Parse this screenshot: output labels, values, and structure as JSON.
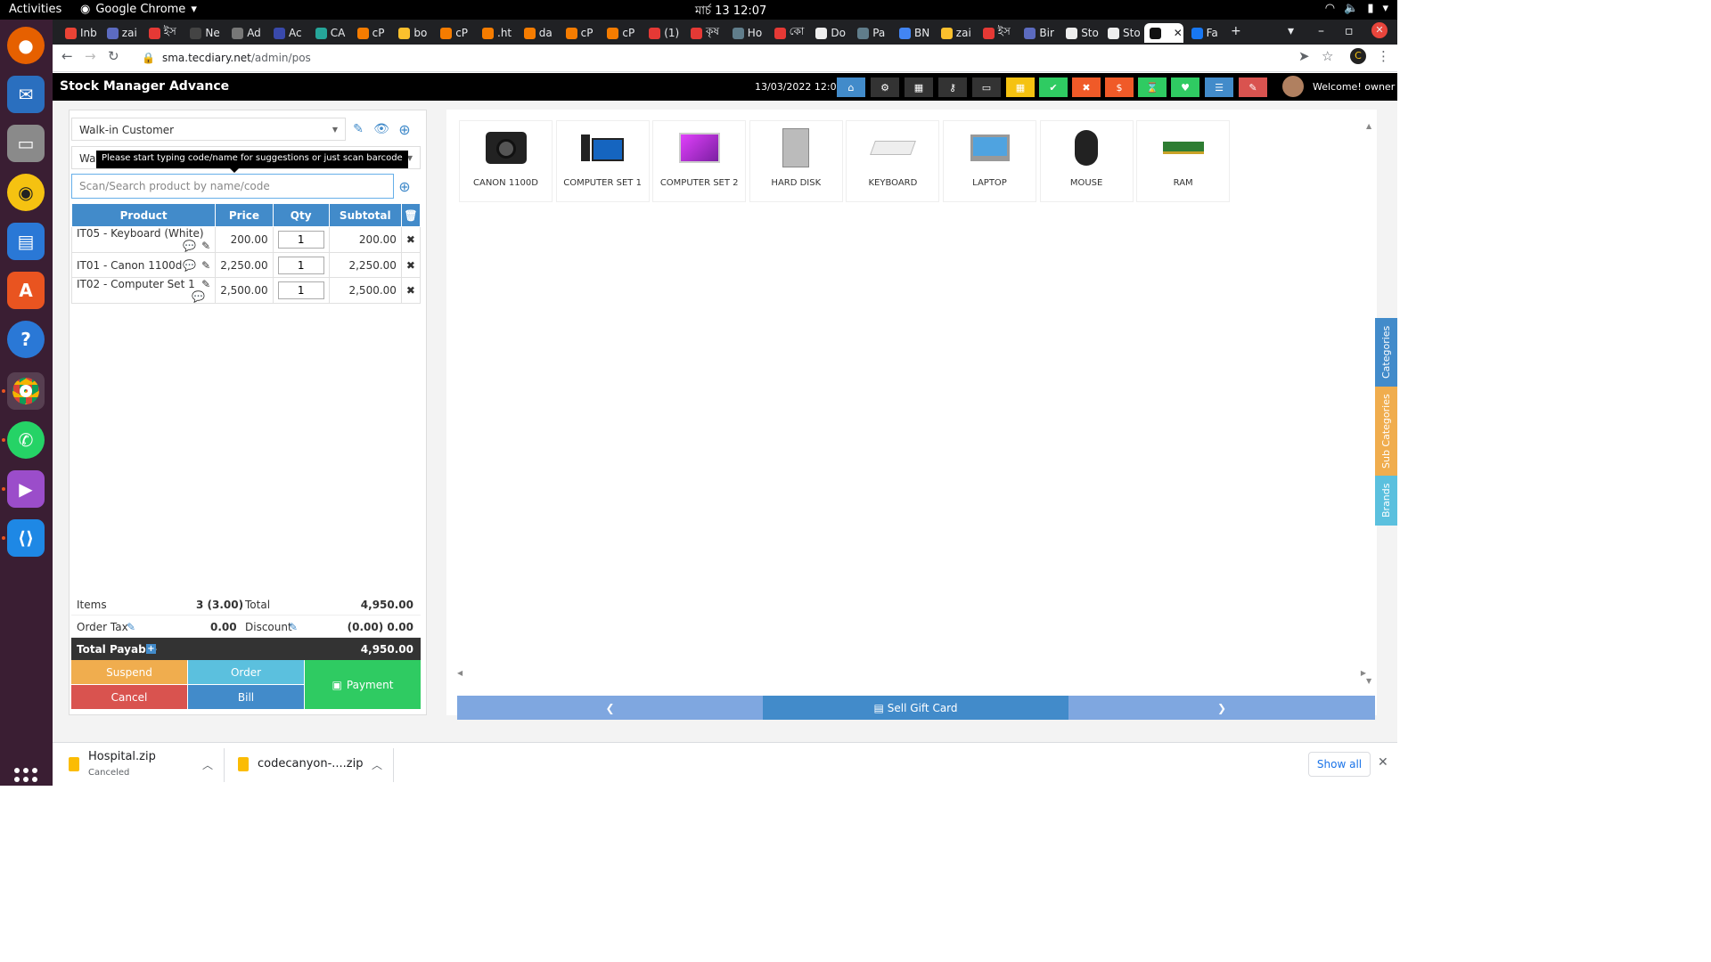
{
  "os": {
    "activities": "Activities",
    "app_name": "Google Chrome",
    "clock": "মার্চ 13  12:07"
  },
  "browser": {
    "tabs": [
      "Inb",
      "zai",
      "ইস",
      "Ne",
      "Ad",
      "Ac",
      "CA",
      "cP",
      "bo",
      "cP",
      ".ht",
      "da",
      "cP",
      "cP",
      "(1)",
      "কৃষ",
      "Ho",
      "কো",
      "Do",
      "Pa",
      "BN",
      "zai",
      "ইস",
      "Bir",
      "Sto",
      "Sto",
      "",
      "Fa"
    ],
    "url_host": "sma.tecdiary.net",
    "url_path": "/admin/pos"
  },
  "header": {
    "brand": "Stock Manager Advance",
    "datetime": "13/03/2022 12:07",
    "welcome": "Welcome! owner"
  },
  "pos": {
    "customer": "Walk-in Customer",
    "warehouse_prefix": "War",
    "tooltip": "Please start typing code/name for suggestions or just scan barcode",
    "search_placeholder": "Scan/Search product by name/code",
    "columns": {
      "product": "Product",
      "price": "Price",
      "qty": "Qty",
      "subtotal": "Subtotal"
    },
    "items": [
      {
        "name": "IT05 - Keyboard (White)",
        "price": "200.00",
        "qty": "1",
        "subtotal": "200.00"
      },
      {
        "name": "IT01 - Canon 1100d",
        "price": "2,250.00",
        "qty": "1",
        "subtotal": "2,250.00"
      },
      {
        "name": "IT02 - Computer Set 1",
        "price": "2,500.00",
        "qty": "1",
        "subtotal": "2,500.00"
      }
    ],
    "totals": {
      "items_label": "Items",
      "items_value": "3 (3.00)",
      "total_label": "Total",
      "total_value": "4,950.00",
      "tax_label": "Order Tax",
      "tax_value": "0.00",
      "discount_label": "Discount",
      "discount_value": "(0.00) 0.00",
      "payable_label": "Total Payable",
      "payable_value": "4,950.00"
    },
    "buttons": {
      "suspend": "Suspend",
      "order": "Order",
      "payment": "Payment",
      "cancel": "Cancel",
      "bill": "Bill"
    }
  },
  "products": [
    "CANON 1100D",
    "COMPUTER SET 1",
    "COMPUTER SET 2",
    "HARD DISK",
    "KEYBOARD",
    "LAPTOP",
    "MOUSE",
    "RAM"
  ],
  "product_nav": {
    "gift": "Sell Gift Card"
  },
  "side_tabs": {
    "categories": "Categories",
    "sub_categories": "Sub Categories",
    "brands": "Brands"
  },
  "downloads": [
    {
      "name": "Hospital.zip",
      "status": "Canceled"
    },
    {
      "name": "codecanyon-....zip",
      "status": ""
    }
  ],
  "downloads_show_all": "Show all",
  "colors": {
    "primary": "#428bca",
    "suspend": "#f0ad4e",
    "order": "#5bc0de",
    "payment": "#2fcb62",
    "cancel": "#d9534f",
    "bill": "#428bca",
    "sidebar": "#3a1e33"
  }
}
